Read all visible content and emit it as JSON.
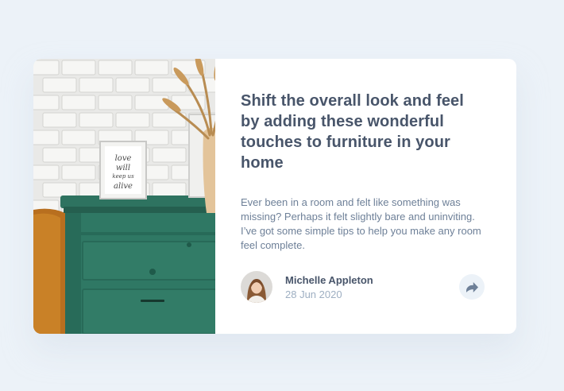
{
  "article": {
    "title": "Shift the overall look and feel by adding these wonderful touches to furniture in your home",
    "description": "Ever been in a room and felt like something was missing? Perhaps it felt slightly bare and uninviting. I’ve got some simple tips to help you make any room feel complete.",
    "image_alt": "Green drawers with a framed quote and dried grass in a vase"
  },
  "author": {
    "name": "Michelle Appleton",
    "date": "28 Jun 2020"
  },
  "share": {
    "icon": "share-icon"
  },
  "frame_quote": {
    "lines": [
      "love",
      "will",
      "keep us",
      "alive"
    ]
  },
  "colors": {
    "background": "#ecf2f8",
    "card": "#ffffff",
    "title": "#48556a",
    "body_text": "#6e8098",
    "muted": "#9eafc2",
    "share_bg": "#ecf2f8",
    "share_icon": "#6e8098"
  }
}
